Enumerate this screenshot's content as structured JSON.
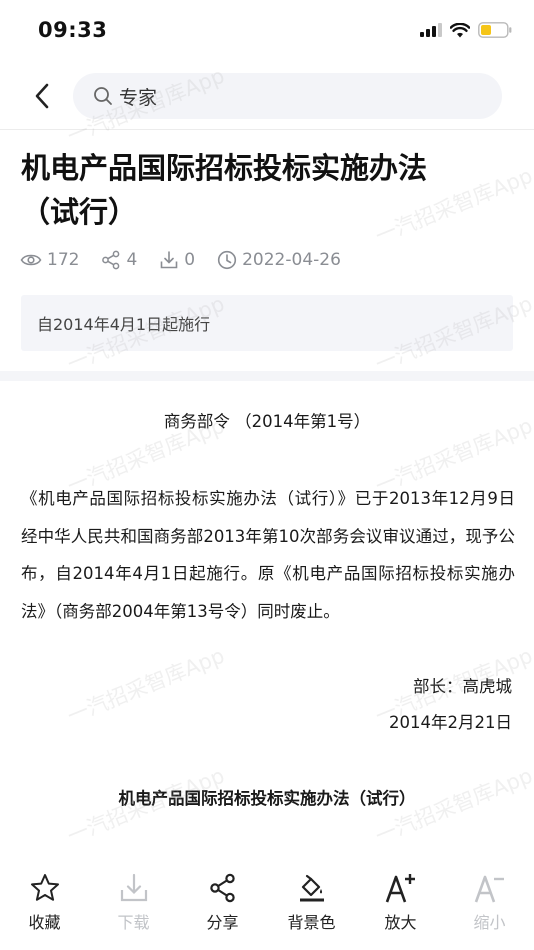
{
  "status_bar": {
    "time": "09:33"
  },
  "header": {
    "search_text": "专家"
  },
  "article": {
    "title": "机电产品国际招标投标实施办法（试行）",
    "views": "172",
    "shares": "4",
    "downloads": "0",
    "date": "2022-04-26",
    "notice": "自2014年4月1日起施行",
    "order_line": "商务部令 （2014年第1号）",
    "paragraph": "《机电产品国际招标投标实施办法（试行）》已于2013年12月9日经中华人民共和国商务部2013年第10次部务会议审议通过，现予公布，自2014年4月1日起施行。原《机电产品国际招标投标实施办法》（商务部2004年第13号令）同时废止。",
    "signer": "部长：高虎城",
    "sign_date": "2014年2月21日",
    "section_title": "机电产品国际招标投标实施办法（试行）"
  },
  "watermark": "一汽招采智库App",
  "toolbar": {
    "favorite": "收藏",
    "download": "下载",
    "share": "分享",
    "background": "背景色",
    "zoom_in": "放大",
    "zoom_out": "缩小"
  },
  "colors": {
    "battery": "#f5c518",
    "disabled": "#c2c4c8",
    "meta": "#8a8d93"
  }
}
